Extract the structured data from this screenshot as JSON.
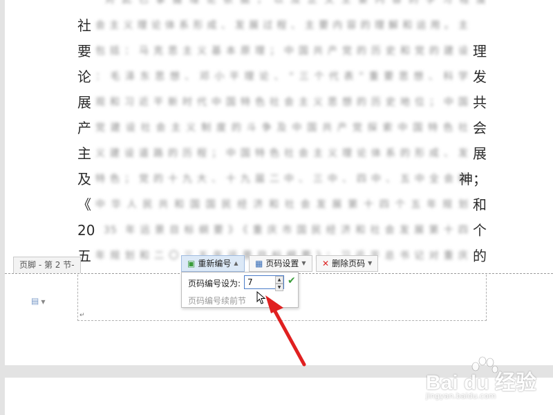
{
  "document": {
    "lines": [
      {
        "first": "",
        "mid": "对此已掌握理论依据，以及正文主要内容的学习程度",
        "last": ""
      },
      {
        "first": "社",
        "mid": "会主义理论体系形成、发展过程、主要内容的理解和运用。主",
        "last": ""
      },
      {
        "first": "要",
        "mid": "包括：马克思主义基本原理；中国共产党的历史和党的建设",
        "last": "理"
      },
      {
        "first": "论",
        "mid": "：毛泽东思想、邓小平理论、“三个代表”重要思想、科学",
        "last": "发"
      },
      {
        "first": "展",
        "mid": "观和习近平新时代中国特色社会主义思想的历史地位；中国",
        "last": "共"
      },
      {
        "first": "产",
        "mid": "党建设社会主义制度的斗争及中国共产党探索中国特色社",
        "last": "会"
      },
      {
        "first": "主",
        "mid": "义建设道路的历程；中国特色社会主义理论体系的形成、发",
        "last": "展"
      },
      {
        "first": "及",
        "mid": "特色；党的十九大、十九届二中、三中、四中、五中全会精",
        "last": "神；"
      },
      {
        "first": "《",
        "mid": "中华人民共和国国民经济和社会发展第十四个五年规划",
        "last": "和"
      },
      {
        "first": "20",
        "mid": "35 年远景目标纲要》《重庆市国民经济和社会发展第十四",
        "last": "个"
      },
      {
        "first": "五",
        "mid": "年规划和二〇三五年远景目标纲要》；习近平总书记对重庆",
        "last": "的"
      }
    ]
  },
  "footer": {
    "section_label": "页脚 - 第 2 节-"
  },
  "toolbar": {
    "renumber_label": "重新编号",
    "page_setup_label": "页码设置",
    "delete_label": "删除页码"
  },
  "popup": {
    "set_label": "页码编号设为:",
    "value": "7",
    "continue_label": "页码编号续前节"
  },
  "watermark": {
    "brand": "Bai du 经验",
    "url": "jingyan.baidu.com"
  },
  "colors": {
    "accent": "#4a7cc9",
    "confirm": "#3a9d3a",
    "arrow": "#e02020"
  }
}
